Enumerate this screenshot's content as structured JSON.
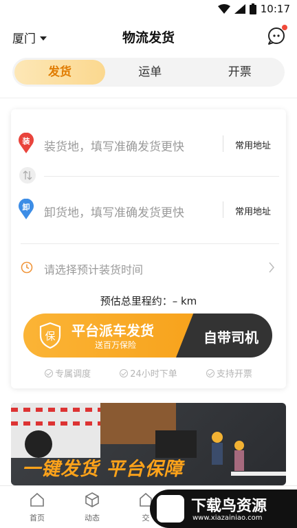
{
  "status_bar": {
    "time": "10:17"
  },
  "header": {
    "city": "厦门",
    "title": "物流发货"
  },
  "tabs": [
    {
      "label": "发货",
      "active": true
    },
    {
      "label": "运单",
      "active": false
    },
    {
      "label": "开票",
      "active": false
    }
  ],
  "form": {
    "load_badge": "装",
    "load_placeholder": "装货地，填写准确发货更快",
    "load_common": "常用地址",
    "unload_badge": "卸",
    "unload_placeholder": "卸货地，填写准确发货更快",
    "unload_common": "常用地址",
    "time_placeholder": "请选择预计装货时间",
    "mileage": "预估总里程约：– km"
  },
  "dispatch": {
    "badge": "保",
    "main": "平台派车发货",
    "sub": "送百万保险",
    "self_driver": "自带司机"
  },
  "features": [
    "专属调度",
    "24小时下单",
    "支持开票"
  ],
  "banner": {
    "text": "一键发货 平台保障"
  },
  "bottom_nav": [
    {
      "label": "首页",
      "icon": "home-icon"
    },
    {
      "label": "动态",
      "icon": "cube-icon"
    },
    {
      "label": "交",
      "icon": "exchange-icon"
    }
  ],
  "watermark": {
    "main": "下载鸟资源",
    "sub": "www.xiazainiao.com"
  },
  "colors": {
    "accent": "#f7a21b",
    "load_pin": "#e9443c",
    "unload_pin": "#3d8de6",
    "dark": "#333333"
  }
}
